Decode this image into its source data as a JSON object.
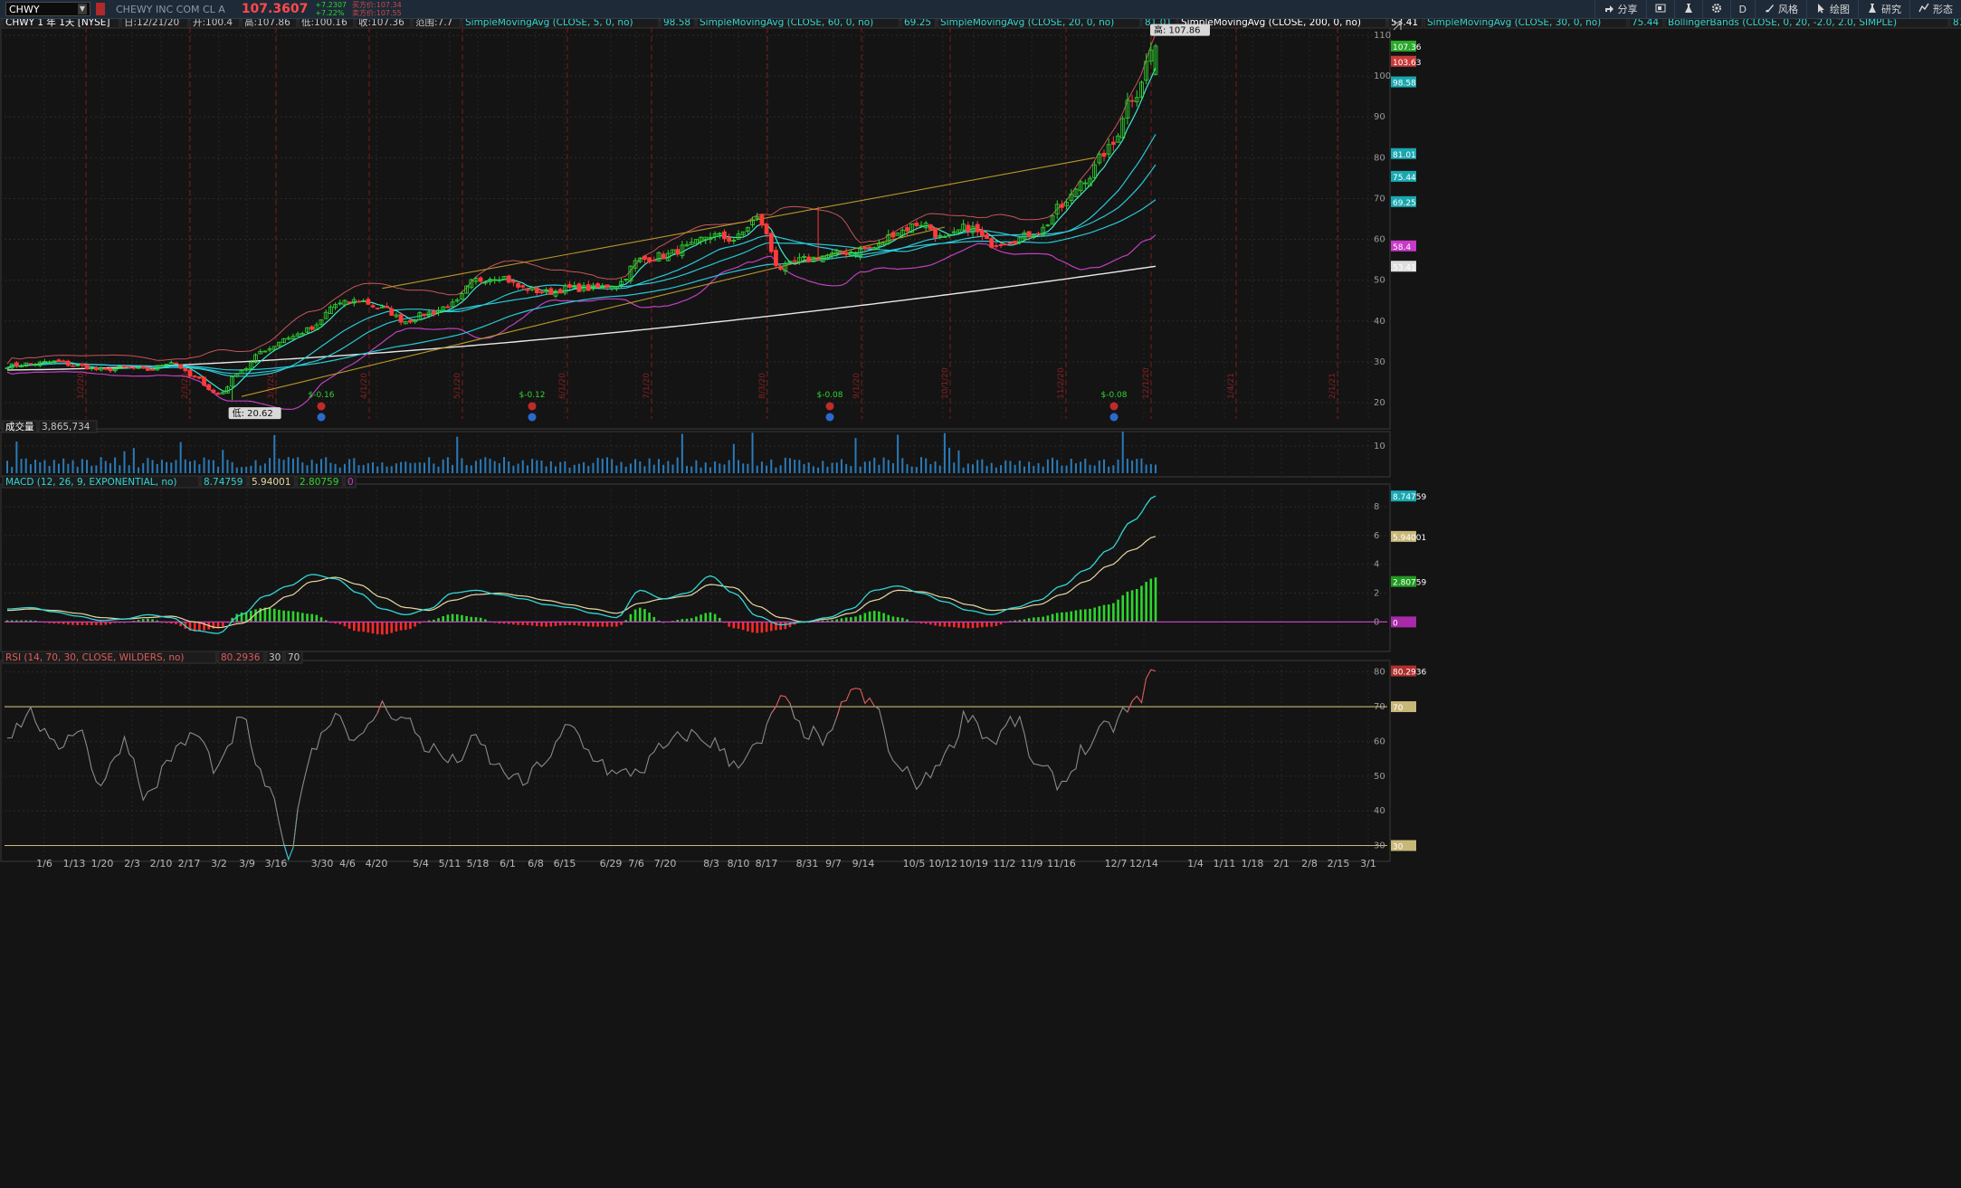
{
  "header": {
    "symbol": "CHWY",
    "company": "CHEWY INC COM CL A",
    "last_price": "107.3607",
    "change_abs": "+7.2307",
    "change_pct": "+7.22%",
    "bid": "买方价:107.34",
    "ask": "卖方价:107.55"
  },
  "toolbar": [
    {
      "name": "share",
      "label": "分享",
      "icon": "share-icon"
    },
    {
      "name": "layout",
      "label": "",
      "icon": "layout-icon"
    },
    {
      "name": "flask",
      "label": "",
      "icon": "flask-icon"
    },
    {
      "name": "settings",
      "label": "",
      "icon": "gear-icon"
    },
    {
      "name": "timeframe",
      "label": "D",
      "icon": ""
    },
    {
      "name": "style",
      "label": "风格",
      "icon": "brush-icon"
    },
    {
      "name": "drawing",
      "label": "绘图",
      "icon": "cursor-icon"
    },
    {
      "name": "studies",
      "label": "研究",
      "icon": "flask-icon"
    },
    {
      "name": "patterns",
      "label": "形态",
      "icon": "pattern-icon"
    }
  ],
  "price_panel": {
    "title": "CHWY 1 年 1天 [NYSE]",
    "ohlc": [
      {
        "text": "日:12/21/20",
        "color": "#c8c8c8"
      },
      {
        "text": "开:100.4",
        "color": "#c8c8c8"
      },
      {
        "text": "高:107.86",
        "color": "#c8c8c8"
      },
      {
        "text": "低:100.16",
        "color": "#c8c8c8"
      },
      {
        "text": "收:107.36",
        "color": "#c8c8c8"
      },
      {
        "text": "范围:7.7",
        "color": "#c8c8c8"
      }
    ],
    "studies": [
      {
        "label": "SimpleMovingAvg (CLOSE, 5, 0, no)",
        "value": "98.58",
        "color": "#33d6d6"
      },
      {
        "label": "SimpleMovingAvg (CLOSE, 60, 0, no)",
        "value": "69.25",
        "color": "#33d6d6"
      },
      {
        "label": "SimpleMovingAvg (CLOSE, 20, 0, no)",
        "value": "81.01",
        "color": "#33d6d6"
      },
      {
        "label": "SimpleMovingAvg (CLOSE, 200, 0, no)",
        "value": "53.41",
        "color": "#ffffff"
      },
      {
        "label": "SimpleMovingAvg (CLOSE, 30, 0, no)",
        "value": "75.44",
        "color": "#33d6d6"
      },
      {
        "label": "BollingerBands (CLOSE, 0, 20, -2.0, 2.0, SIMPLE)",
        "value": "81.01",
        "color": "#33d6d6"
      },
      {
        "label": "",
        "value": "58.4",
        "color": "#e05ae0"
      },
      {
        "label": "",
        "value": "103.63",
        "color": "#e05a5a"
      }
    ],
    "high_tag": "高: 107.86",
    "low_tag": "低: 20.62",
    "right_tags": [
      {
        "value": "107.36",
        "color": "#2aa82a",
        "price": 107.36
      },
      {
        "value": "103.63",
        "color": "#c83a3a",
        "price": 103.63
      },
      {
        "value": "98.58",
        "color": "#1aa8b0",
        "price": 98.58
      },
      {
        "value": "81.01",
        "color": "#1aa8b0",
        "price": 81.01
      },
      {
        "value": "75.44",
        "color": "#1aa8b0",
        "price": 75.44
      },
      {
        "value": "69.25",
        "color": "#1aa8b0",
        "price": 69.25
      },
      {
        "value": "58.4",
        "color": "#c83ac8",
        "price": 58.4
      },
      {
        "value": "53.41",
        "color": "#dddddd",
        "price": 53.41
      }
    ],
    "earnings": [
      {
        "value": "$-0.16",
        "date": "3/30"
      },
      {
        "value": "$-0.12",
        "date": "6/8"
      },
      {
        "value": "$-0.08",
        "date": "9/7"
      },
      {
        "value": "$-0.08",
        "date": "12/7"
      }
    ],
    "month_labels": [
      "1/2/20",
      "2/3/20",
      "3/2/20",
      "4/1/20",
      "5/1/20",
      "6/1/20",
      "7/1/20",
      "8/3/20",
      "9/1/20",
      "10/1/20",
      "11/2/20",
      "12/1/20",
      "1/4/21",
      "2/1/21"
    ]
  },
  "volume_panel": {
    "title": "成交量",
    "value": "3,865,734",
    "yticks": [
      "10"
    ]
  },
  "macd_panel": {
    "title": "MACD (12, 26, 9, EXPONENTIAL, no)",
    "values": [
      {
        "text": "8.74759",
        "color": "#33d6d6"
      },
      {
        "text": "5.94001",
        "color": "#e8d8a0"
      },
      {
        "text": "2.80759",
        "color": "#2ed52e"
      },
      {
        "text": "0",
        "color": "#c83ac8"
      }
    ],
    "right_tags": [
      {
        "value": "8.74759",
        "color": "#1aa8b0",
        "level": 8.74759
      },
      {
        "value": "5.94001",
        "color": "#c8b878",
        "level": 5.94001
      },
      {
        "value": "2.80759",
        "color": "#1f9a1f",
        "level": 2.80759
      },
      {
        "value": "0",
        "color": "#a82aa8",
        "level": 0
      }
    ]
  },
  "rsi_panel": {
    "title": "RSI (14, 70, 30, CLOSE, WILDERS, no)",
    "values": [
      {
        "text": "80.2936",
        "color": "#e05a5a"
      },
      {
        "text": "30",
        "color": "#c8c8c8"
      },
      {
        "text": "70",
        "color": "#c8c8c8"
      }
    ],
    "right_tags": [
      {
        "value": "80.2936",
        "color": "#b03030",
        "level": 80.2936
      },
      {
        "value": "70",
        "color": "#c8b878",
        "level": 70
      },
      {
        "value": "30",
        "color": "#c8b878",
        "level": 30
      }
    ]
  },
  "x_axis": [
    "1/6",
    "1/13",
    "1/20",
    "2/3",
    "2/10",
    "2/17",
    "3/2",
    "3/9",
    "3/16",
    "3/30",
    "4/6",
    "4/20",
    "5/4",
    "5/11",
    "5/18",
    "6/1",
    "6/8",
    "6/15",
    "6/29",
    "7/6",
    "7/20",
    "8/3",
    "8/10",
    "8/17",
    "8/31",
    "9/7",
    "9/14",
    "10/5",
    "10/12",
    "10/19",
    "11/2",
    "11/9",
    "11/16",
    "12/7",
    "12/14",
    "1/4",
    "1/11",
    "1/18",
    "2/1",
    "2/8",
    "2/15",
    "3/1"
  ],
  "chart_data": {
    "type": "candlestick",
    "price_yticks": [
      20,
      30,
      40,
      50,
      60,
      70,
      80,
      90,
      100,
      110
    ],
    "price_ylim": [
      16,
      112
    ],
    "macd_yticks": [
      0,
      2,
      4,
      6,
      8
    ],
    "macd_ylim": [
      -1.8,
      9.2
    ],
    "rsi_yticks": [
      30,
      40,
      50,
      60,
      70,
      80
    ],
    "rsi_ylim": [
      27,
      82
    ],
    "volume_ylim": [
      0,
      14
    ],
    "x_dates": [
      "1/6",
      "1/13",
      "1/20",
      "2/3",
      "2/10",
      "2/17",
      "3/2",
      "3/9",
      "3/16",
      "3/30",
      "4/6",
      "4/20",
      "5/4",
      "5/11",
      "5/18",
      "6/1",
      "6/8",
      "6/15",
      "6/29",
      "7/6",
      "7/20",
      "8/3",
      "8/10",
      "8/17",
      "8/31",
      "9/7",
      "9/14",
      "10/5",
      "10/12",
      "10/19",
      "11/2",
      "11/9",
      "11/16",
      "12/7",
      "12/14"
    ],
    "close_anchors": [
      29,
      29.5,
      30,
      29,
      28,
      28.5,
      28,
      30,
      26,
      22,
      28,
      33,
      36,
      38,
      44,
      45,
      43,
      40,
      42,
      44,
      50,
      51,
      48,
      47,
      48,
      48,
      49,
      55,
      56,
      58,
      61,
      60,
      65,
      53,
      55,
      56,
      57,
      58,
      62,
      64,
      60,
      63,
      59,
      60,
      62,
      68,
      75,
      82,
      95,
      107.36
    ],
    "macd_anchors": [
      0.9,
      1.0,
      0.7,
      0.4,
      0.1,
      0.2,
      0.5,
      0.3,
      -0.6,
      -0.8,
      0.5,
      1.8,
      2.5,
      3.3,
      3.0,
      2.0,
      0.9,
      0.5,
      0.9,
      2.0,
      2.2,
      1.9,
      1.6,
      1.2,
      1.0,
      0.6,
      0.3,
      2.2,
      1.6,
      2.0,
      3.2,
      2.0,
      0.4,
      -0.2,
      0,
      0.3,
      0.9,
      2.2,
      2.5,
      2.0,
      1.4,
      0.8,
      0.5,
      1.0,
      1.5,
      2.5,
      3.6,
      5.0,
      7.0,
      8.75
    ],
    "signal_anchors": [
      0.8,
      0.9,
      0.8,
      0.6,
      0.3,
      0.2,
      0.3,
      0.4,
      0.0,
      -0.4,
      -0.1,
      0.9,
      1.8,
      2.8,
      3.1,
      2.6,
      1.7,
      1.0,
      0.8,
      1.5,
      1.9,
      2.0,
      1.8,
      1.5,
      1.2,
      0.9,
      0.6,
      1.3,
      1.6,
      1.8,
      2.6,
      2.4,
      1.1,
      0.3,
      0.0,
      0.2,
      0.6,
      1.5,
      2.2,
      2.1,
      1.7,
      1.2,
      0.8,
      0.9,
      1.2,
      1.9,
      2.8,
      3.9,
      5.0,
      5.94
    ],
    "rsi_anchors": [
      62,
      68,
      58,
      64,
      48,
      60,
      44,
      56,
      62,
      52,
      66,
      48,
      28,
      58,
      68,
      60,
      70,
      66,
      58,
      54,
      60,
      52,
      48,
      55,
      64,
      56,
      50,
      52,
      58,
      62,
      60,
      54,
      58,
      72,
      63,
      60,
      75,
      70,
      52,
      48,
      56,
      68,
      60,
      66,
      52,
      48,
      58,
      64,
      70,
      80.29
    ]
  }
}
